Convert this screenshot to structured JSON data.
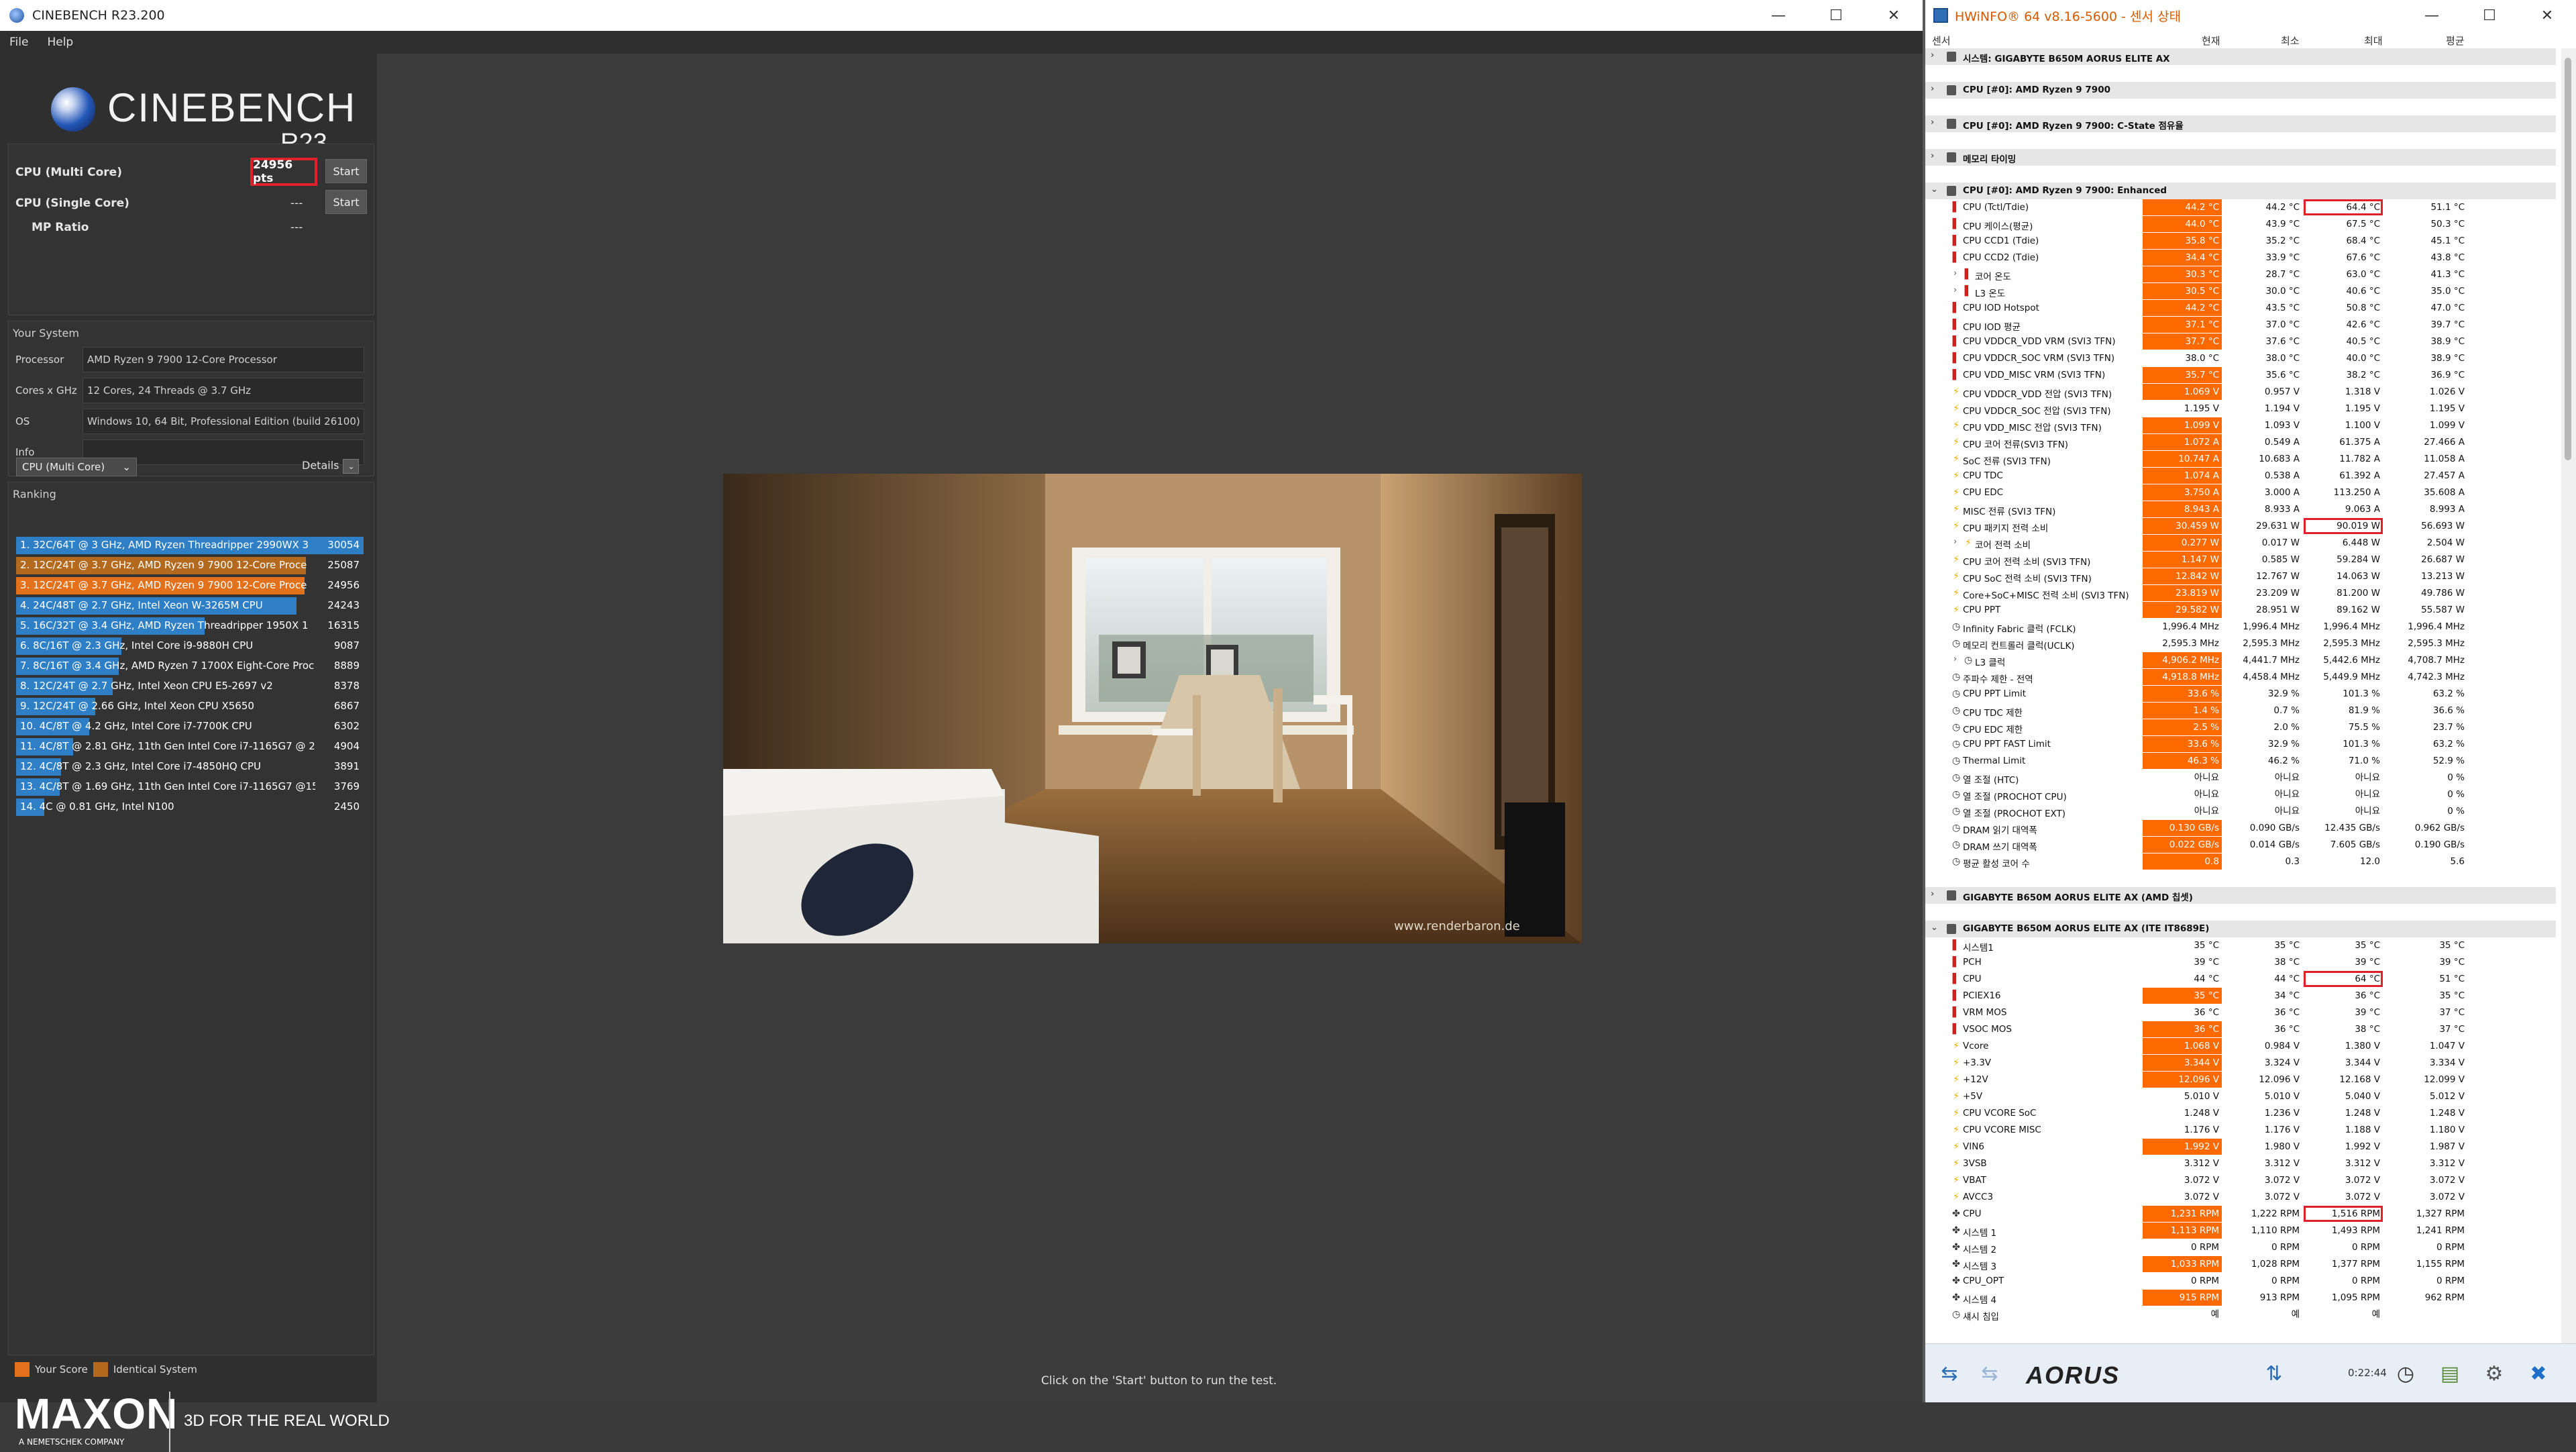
{
  "cinebench": {
    "title": "CINEBENCH R23.200",
    "menu": [
      "File",
      "Help"
    ],
    "logo": {
      "word": "CINEBENCH",
      "version": "R23"
    },
    "tests": {
      "multi_label": "CPU (Multi Core)",
      "multi_score": "24956 pts",
      "single_label": "CPU (Single Core)",
      "single_score": "---",
      "mp_label": "MP Ratio",
      "mp_value": "---",
      "start": "Start"
    },
    "system": {
      "heading": "Your System",
      "rows": [
        {
          "k": "Processor",
          "v": "AMD Ryzen 9 7900 12-Core Processor"
        },
        {
          "k": "Cores x GHz",
          "v": "12 Cores, 24 Threads @ 3.7 GHz"
        },
        {
          "k": "OS",
          "v": "Windows 10, 64 Bit, Professional Edition (build 26100)"
        },
        {
          "k": "Info",
          "v": ""
        }
      ]
    },
    "ranking": {
      "heading": "Ranking",
      "select": "CPU (Multi Core)",
      "details": "Details",
      "rows": [
        {
          "label": "1. 32C/64T @ 3 GHz, AMD Ryzen Threadripper 2990WX 3",
          "score": "30054",
          "value": 30054,
          "kind": "other"
        },
        {
          "label": "2. 12C/24T @ 3.7 GHz, AMD Ryzen 9 7900 12-Core Proce",
          "score": "25087",
          "value": 25087,
          "kind": "ident"
        },
        {
          "label": "3. 12C/24T @ 3.7 GHz, AMD Ryzen 9 7900 12-Core Proce",
          "score": "24956",
          "value": 24956,
          "kind": "yours"
        },
        {
          "label": "4. 24C/48T @ 2.7 GHz, Intel Xeon W-3265M CPU",
          "score": "24243",
          "value": 24243,
          "kind": "other"
        },
        {
          "label": "5. 16C/32T @ 3.4 GHz, AMD Ryzen Threadripper 1950X 1",
          "score": "16315",
          "value": 16315,
          "kind": "other"
        },
        {
          "label": "6. 8C/16T @ 2.3 GHz, Intel Core i9-9880H CPU",
          "score": "9087",
          "value": 9087,
          "kind": "other"
        },
        {
          "label": "7. 8C/16T @ 3.4 GHz, AMD Ryzen 7 1700X Eight-Core Proc",
          "score": "8889",
          "value": 8889,
          "kind": "other"
        },
        {
          "label": "8. 12C/24T @ 2.7 GHz, Intel Xeon CPU E5-2697 v2",
          "score": "8378",
          "value": 8378,
          "kind": "other"
        },
        {
          "label": "9. 12C/24T @ 2.66 GHz, Intel Xeon CPU X5650",
          "score": "6867",
          "value": 6867,
          "kind": "other"
        },
        {
          "label": "10. 4C/8T @ 4.2 GHz, Intel Core i7-7700K CPU",
          "score": "6302",
          "value": 6302,
          "kind": "other"
        },
        {
          "label": "11. 4C/8T @ 2.81 GHz, 11th Gen Intel Core i7-1165G7 @ 2",
          "score": "4904",
          "value": 4904,
          "kind": "other"
        },
        {
          "label": "12. 4C/8T @ 2.3 GHz, Intel Core i7-4850HQ CPU",
          "score": "3891",
          "value": 3891,
          "kind": "other"
        },
        {
          "label": "13. 4C/8T @ 1.69 GHz, 11th Gen Intel Core i7-1165G7 @15",
          "score": "3769",
          "value": 3769,
          "kind": "other"
        },
        {
          "label": "14. 4C @ 0.81 GHz, Intel N100",
          "score": "2450",
          "value": 2450,
          "kind": "other"
        }
      ]
    },
    "legend": {
      "yours": "Your Score",
      "ident": "Identical System"
    },
    "colors": {
      "yours": "#e3701a",
      "ident": "#b36a1e",
      "other": "#2f7fc6"
    },
    "brand": {
      "name": "MAXON",
      "sub": "A NEMETSCHEK COMPANY",
      "tagline": "3D FOR THE REAL WORLD"
    },
    "render_watermark": "www.renderbaron.de",
    "status": "Click on the 'Start' button to run the test."
  },
  "hwinfo": {
    "title": "HWiNFO® 64 v8.16-5600 - 센서 상태",
    "columns": {
      "sensor": "센서",
      "current": "현재",
      "min": "최소",
      "max": "최대",
      "avg": "평균"
    },
    "rows": [
      {
        "t": "grp",
        "n": "시스템: GIGABYTE B650M AORUS ELITE AX",
        "arrow": ">"
      },
      {
        "t": "sp"
      },
      {
        "t": "grp",
        "n": "CPU [#0]: AMD Ryzen 9 7900",
        "arrow": ">"
      },
      {
        "t": "sp"
      },
      {
        "t": "grp",
        "n": "CPU [#0]: AMD Ryzen 9 7900: C-State 점유율",
        "arrow": ">"
      },
      {
        "t": "sp"
      },
      {
        "t": "grp",
        "n": "메모리 타이밍",
        "arrow": ">"
      },
      {
        "t": "sp"
      },
      {
        "t": "grp",
        "n": "CPU [#0]: AMD Ryzen 9 7900: Enhanced",
        "arrow": "v"
      },
      {
        "i": "t",
        "n": "CPU (Tctl/Tdie)",
        "v": [
          "44.2 °C",
          "44.2 °C",
          "64.4 °C",
          "51.1 °C"
        ],
        "h": 1,
        "b": 3
      },
      {
        "i": "t",
        "n": "CPU 케이스(평균)",
        "v": [
          "44.0 °C",
          "43.9 °C",
          "67.5 °C",
          "50.3 °C"
        ],
        "h": 1
      },
      {
        "i": "t",
        "n": "CPU CCD1 (Tdie)",
        "v": [
          "35.8 °C",
          "35.2 °C",
          "68.4 °C",
          "45.1 °C"
        ],
        "h": 1
      },
      {
        "i": "t",
        "n": "CPU CCD2 (Tdie)",
        "v": [
          "34.4 °C",
          "33.9 °C",
          "67.6 °C",
          "43.8 °C"
        ],
        "h": 1
      },
      {
        "i": "t",
        "n": "코어 온도",
        "v": [
          "30.3 °C",
          "28.7 °C",
          "63.0 °C",
          "41.3 °C"
        ],
        "h": 1,
        "s": 1
      },
      {
        "i": "t",
        "n": "L3 온도",
        "v": [
          "30.5 °C",
          "30.0 °C",
          "40.6 °C",
          "35.0 °C"
        ],
        "h": 1,
        "s": 1
      },
      {
        "i": "t",
        "n": "CPU IOD Hotspot",
        "v": [
          "44.2 °C",
          "43.5 °C",
          "50.8 °C",
          "47.0 °C"
        ],
        "h": 1
      },
      {
        "i": "t",
        "n": "CPU IOD 평균",
        "v": [
          "37.1 °C",
          "37.0 °C",
          "42.6 °C",
          "39.7 °C"
        ],
        "h": 1
      },
      {
        "i": "t",
        "n": "CPU VDDCR_VDD VRM (SVI3 TFN)",
        "v": [
          "37.7 °C",
          "37.6 °C",
          "40.5 °C",
          "38.9 °C"
        ],
        "h": 1
      },
      {
        "i": "t",
        "n": "CPU VDDCR_SOC VRM (SVI3 TFN)",
        "v": [
          "38.0 °C",
          "38.0 °C",
          "40.0 °C",
          "38.9 °C"
        ]
      },
      {
        "i": "t",
        "n": "CPU VDD_MISC VRM (SVI3 TFN)",
        "v": [
          "35.7 °C",
          "35.6 °C",
          "38.2 °C",
          "36.9 °C"
        ],
        "h": 1
      },
      {
        "i": "v",
        "n": "CPU VDDCR_VDD 전압 (SVI3 TFN)",
        "v": [
          "1.069 V",
          "0.957 V",
          "1.318 V",
          "1.026 V"
        ],
        "h": 1
      },
      {
        "i": "v",
        "n": "CPU VDDCR_SOC 전압 (SVI3 TFN)",
        "v": [
          "1.195 V",
          "1.194 V",
          "1.195 V",
          "1.195 V"
        ]
      },
      {
        "i": "v",
        "n": "CPU VDD_MISC 전압 (SVI3 TFN)",
        "v": [
          "1.099 V",
          "1.093 V",
          "1.100 V",
          "1.099 V"
        ],
        "h": 1
      },
      {
        "i": "v",
        "n": "CPU 코어 전류(SVI3 TFN)",
        "v": [
          "1.072 A",
          "0.549 A",
          "61.375 A",
          "27.466 A"
        ],
        "h": 1
      },
      {
        "i": "v",
        "n": "SoC 전류 (SVI3 TFN)",
        "v": [
          "10.747 A",
          "10.683 A",
          "11.782 A",
          "11.058 A"
        ],
        "h": 1
      },
      {
        "i": "v",
        "n": "CPU TDC",
        "v": [
          "1.074 A",
          "0.538 A",
          "61.392 A",
          "27.457 A"
        ],
        "h": 1
      },
      {
        "i": "v",
        "n": "CPU EDC",
        "v": [
          "3.750 A",
          "3.000 A",
          "113.250 A",
          "35.608 A"
        ],
        "h": 1
      },
      {
        "i": "v",
        "n": "MISC 전류 (SVI3 TFN)",
        "v": [
          "8.943 A",
          "8.933 A",
          "9.063 A",
          "8.993 A"
        ],
        "h": 1
      },
      {
        "i": "v",
        "n": "CPU 패키지 전력 소비",
        "v": [
          "30.459 W",
          "29.631 W",
          "90.019 W",
          "56.693 W"
        ],
        "h": 1,
        "b": 3
      },
      {
        "i": "v",
        "n": "코어 전력 소비",
        "v": [
          "0.277 W",
          "0.017 W",
          "6.448 W",
          "2.504 W"
        ],
        "h": 1,
        "s": 1
      },
      {
        "i": "v",
        "n": "CPU 코어 전력 소비 (SVI3 TFN)",
        "v": [
          "1.147 W",
          "0.585 W",
          "59.284 W",
          "26.687 W"
        ],
        "h": 1
      },
      {
        "i": "v",
        "n": "CPU SoC 전력 소비 (SVI3 TFN)",
        "v": [
          "12.842 W",
          "12.767 W",
          "14.063 W",
          "13.213 W"
        ],
        "h": 1
      },
      {
        "i": "v",
        "n": "Core+SoC+MISC 전력 소비 (SVI3 TFN)",
        "v": [
          "23.819 W",
          "23.209 W",
          "81.200 W",
          "49.786 W"
        ],
        "h": 1
      },
      {
        "i": "v",
        "n": "CPU PPT",
        "v": [
          "29.582 W",
          "28.951 W",
          "89.162 W",
          "55.587 W"
        ],
        "h": 1
      },
      {
        "i": "c",
        "n": "Infinity Fabric 클럭 (FCLK)",
        "v": [
          "1,996.4 MHz",
          "1,996.4 MHz",
          "1,996.4 MHz",
          "1,996.4 MHz"
        ]
      },
      {
        "i": "c",
        "n": "메모리 컨트롤러 클럭(UCLK)",
        "v": [
          "2,595.3 MHz",
          "2,595.3 MHz",
          "2,595.3 MHz",
          "2,595.3 MHz"
        ]
      },
      {
        "i": "c",
        "n": "L3 클럭",
        "v": [
          "4,906.2 MHz",
          "4,441.7 MHz",
          "5,442.6 MHz",
          "4,708.7 MHz"
        ],
        "h": 1,
        "s": 1
      },
      {
        "i": "c",
        "n": "주파수 제한 - 전역",
        "v": [
          "4,918.8 MHz",
          "4,458.4 MHz",
          "5,449.9 MHz",
          "4,742.3 MHz"
        ],
        "h": 1
      },
      {
        "i": "c",
        "n": "CPU PPT Limit",
        "v": [
          "33.6 %",
          "32.9 %",
          "101.3 %",
          "63.2 %"
        ],
        "h": 1
      },
      {
        "i": "c",
        "n": "CPU TDC 제한",
        "v": [
          "1.4 %",
          "0.7 %",
          "81.9 %",
          "36.6 %"
        ],
        "h": 1
      },
      {
        "i": "c",
        "n": "CPU EDC 제한",
        "v": [
          "2.5 %",
          "2.0 %",
          "75.5 %",
          "23.7 %"
        ],
        "h": 1
      },
      {
        "i": "c",
        "n": "CPU PPT FAST Limit",
        "v": [
          "33.6 %",
          "32.9 %",
          "101.3 %",
          "63.2 %"
        ],
        "h": 1
      },
      {
        "i": "c",
        "n": "Thermal Limit",
        "v": [
          "46.3 %",
          "46.2 %",
          "71.0 %",
          "52.9 %"
        ],
        "h": 1
      },
      {
        "i": "c",
        "n": "열 조절 (HTC)",
        "v": [
          "아니요",
          "아니요",
          "아니요",
          "0 %"
        ]
      },
      {
        "i": "c",
        "n": "열 조절 (PROCHOT CPU)",
        "v": [
          "아니요",
          "아니요",
          "아니요",
          "0 %"
        ]
      },
      {
        "i": "c",
        "n": "열 조절 (PROCHOT EXT)",
        "v": [
          "아니요",
          "아니요",
          "아니요",
          "0 %"
        ]
      },
      {
        "i": "c",
        "n": "DRAM 읽기 대역폭",
        "v": [
          "0.130 GB/s",
          "0.090 GB/s",
          "12.435 GB/s",
          "0.962 GB/s"
        ],
        "h": 1
      },
      {
        "i": "c",
        "n": "DRAM 쓰기 대역폭",
        "v": [
          "0.022 GB/s",
          "0.014 GB/s",
          "7.605 GB/s",
          "0.190 GB/s"
        ],
        "h": 1
      },
      {
        "i": "c",
        "n": "평균 활성 코어 수",
        "v": [
          "0.8",
          "0.3",
          "12.0",
          "5.6"
        ],
        "h": 1
      },
      {
        "t": "sp"
      },
      {
        "t": "grp",
        "n": "GIGABYTE B650M AORUS ELITE AX (AMD 칩셋)",
        "arrow": ">"
      },
      {
        "t": "sp"
      },
      {
        "t": "grp",
        "n": "GIGABYTE B650M AORUS ELITE AX (ITE IT8689E)",
        "arrow": "v"
      },
      {
        "i": "t",
        "n": "시스템1",
        "v": [
          "35 °C",
          "35 °C",
          "35 °C",
          "35 °C"
        ]
      },
      {
        "i": "t",
        "n": "PCH",
        "v": [
          "39 °C",
          "38 °C",
          "39 °C",
          "39 °C"
        ]
      },
      {
        "i": "t",
        "n": "CPU",
        "v": [
          "44 °C",
          "44 °C",
          "64 °C",
          "51 °C"
        ],
        "b": 3
      },
      {
        "i": "t",
        "n": "PCIEX16",
        "v": [
          "35 °C",
          "34 °C",
          "36 °C",
          "35 °C"
        ],
        "h": 1
      },
      {
        "i": "t",
        "n": "VRM MOS",
        "v": [
          "36 °C",
          "36 °C",
          "39 °C",
          "37 °C"
        ]
      },
      {
        "i": "t",
        "n": "VSOC MOS",
        "v": [
          "36 °C",
          "36 °C",
          "38 °C",
          "37 °C"
        ],
        "h": 1
      },
      {
        "i": "v",
        "n": "Vcore",
        "v": [
          "1.068 V",
          "0.984 V",
          "1.380 V",
          "1.047 V"
        ],
        "h": 1
      },
      {
        "i": "v",
        "n": "+3.3V",
        "v": [
          "3.344 V",
          "3.324 V",
          "3.344 V",
          "3.334 V"
        ],
        "h": 1
      },
      {
        "i": "v",
        "n": "+12V",
        "v": [
          "12.096 V",
          "12.096 V",
          "12.168 V",
          "12.099 V"
        ],
        "h": 1
      },
      {
        "i": "v",
        "n": "+5V",
        "v": [
          "5.010 V",
          "5.010 V",
          "5.040 V",
          "5.012 V"
        ]
      },
      {
        "i": "v",
        "n": "CPU VCORE SoC",
        "v": [
          "1.248 V",
          "1.236 V",
          "1.248 V",
          "1.248 V"
        ]
      },
      {
        "i": "v",
        "n": "CPU VCORE MISC",
        "v": [
          "1.176 V",
          "1.176 V",
          "1.188 V",
          "1.180 V"
        ]
      },
      {
        "i": "v",
        "n": "VIN6",
        "v": [
          "1.992 V",
          "1.980 V",
          "1.992 V",
          "1.987 V"
        ],
        "h": 1
      },
      {
        "i": "v",
        "n": "3VSB",
        "v": [
          "3.312 V",
          "3.312 V",
          "3.312 V",
          "3.312 V"
        ]
      },
      {
        "i": "v",
        "n": "VBAT",
        "v": [
          "3.072 V",
          "3.072 V",
          "3.072 V",
          "3.072 V"
        ]
      },
      {
        "i": "v",
        "n": "AVCC3",
        "v": [
          "3.072 V",
          "3.072 V",
          "3.072 V",
          "3.072 V"
        ]
      },
      {
        "i": "f",
        "n": "CPU",
        "v": [
          "1,231 RPM",
          "1,222 RPM",
          "1,516 RPM",
          "1,327 RPM"
        ],
        "h": 1,
        "b": 3
      },
      {
        "i": "f",
        "n": "시스템 1",
        "v": [
          "1,113 RPM",
          "1,110 RPM",
          "1,493 RPM",
          "1,241 RPM"
        ],
        "h": 1
      },
      {
        "i": "f",
        "n": "시스템 2",
        "v": [
          "0 RPM",
          "0 RPM",
          "0 RPM",
          "0 RPM"
        ]
      },
      {
        "i": "f",
        "n": "시스템 3",
        "v": [
          "1,033 RPM",
          "1,028 RPM",
          "1,377 RPM",
          "1,155 RPM"
        ],
        "h": 1
      },
      {
        "i": "f",
        "n": "CPU_OPT",
        "v": [
          "0 RPM",
          "0 RPM",
          "0 RPM",
          "0 RPM"
        ]
      },
      {
        "i": "f",
        "n": "시스템 4",
        "v": [
          "915 RPM",
          "913 RPM",
          "1,095 RPM",
          "962 RPM"
        ],
        "h": 1
      },
      {
        "i": "c",
        "n": "섀시 침입",
        "v": [
          "예",
          "예",
          "예",
          ""
        ]
      }
    ],
    "toolbar": {
      "brand": "AORUS",
      "time": "0:22:44"
    }
  }
}
